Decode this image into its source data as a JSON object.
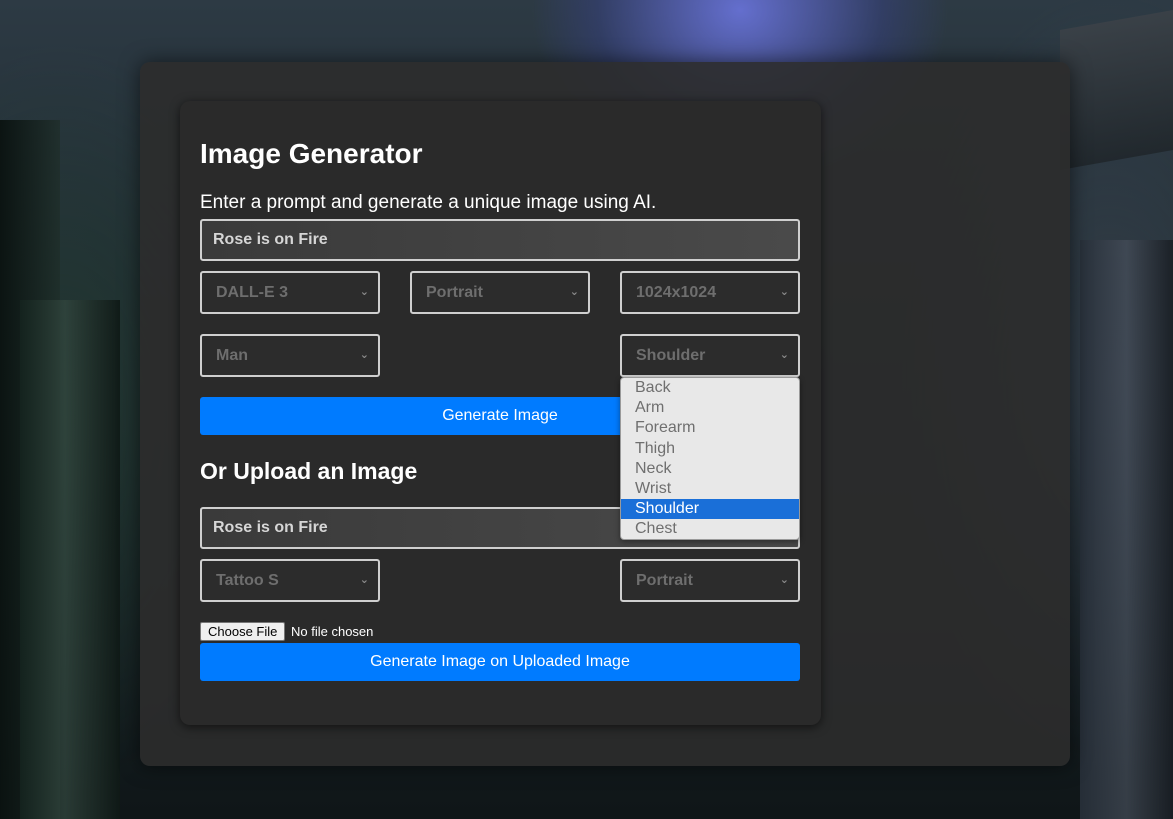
{
  "header": {
    "title": "Image Generator",
    "subtitle": "Enter a prompt and generate a unique image using AI."
  },
  "generate": {
    "prompt_value": "Rose is on Fire",
    "model_select": "DALL-E 3",
    "orientation_select": "Portrait",
    "size_select": "1024x1024",
    "gender_select": "Man",
    "body_part_select": "Shoulder",
    "button_label": "Generate Image"
  },
  "body_part_dropdown": {
    "options": [
      "Back",
      "Arm",
      "Forearm",
      "Thigh",
      "Neck",
      "Wrist",
      "Shoulder",
      "Chest"
    ],
    "selected": "Shoulder"
  },
  "upload": {
    "section_title": "Or Upload an Image",
    "prompt_value": "Rose is on Fire",
    "style_select": "Tattoo S",
    "orientation_select": "Portrait",
    "choose_file_label": "Choose File",
    "file_status": "No file chosen",
    "button_label": "Generate Image on Uploaded Image"
  },
  "colors": {
    "accent": "#007bff",
    "highlight": "#1a6fd8",
    "panel": "#2a2a2a"
  },
  "icons": {
    "select_arrow": "chevron-down-icon"
  }
}
